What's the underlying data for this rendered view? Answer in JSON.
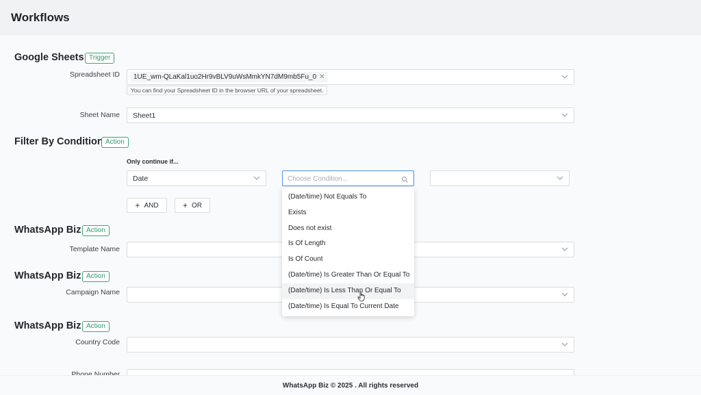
{
  "header": {
    "title": "Workflows"
  },
  "sections": {
    "google_sheets": {
      "title": "Google Sheets",
      "badge": "Trigger"
    },
    "filter": {
      "title": "Filter By Condition",
      "badge": "Action"
    },
    "whatsapp1": {
      "title": "WhatsApp Biz",
      "badge": "Action"
    },
    "whatsapp2": {
      "title": "WhatsApp Biz",
      "badge": "Action"
    },
    "whatsapp3": {
      "title": "WhatsApp Biz",
      "badge": "Action"
    }
  },
  "fields": {
    "spreadsheet_id": {
      "label": "Spreadsheet ID",
      "tag": "1UE_wm-QLaKal1uo2Hr9vBLV9uWsMmkYN7dM9mb5Fu_0",
      "hint": "You can find your Spreadsheet ID in the browser URL of your spreadsheet."
    },
    "sheet_name": {
      "label": "Sheet Name",
      "value": "Sheet1"
    },
    "template_name": {
      "label": "Template Name",
      "value": ""
    },
    "campaign_name": {
      "label": "Campaign Name",
      "value": ""
    },
    "country_code": {
      "label": "Country Code",
      "value": ""
    },
    "phone_number": {
      "label": "Phone Number",
      "value": ""
    }
  },
  "filter": {
    "intro": "Only continue if...",
    "field_value": "Date",
    "condition_placeholder": "Choose Condition...",
    "and_label": "AND",
    "or_label": "OR",
    "options": [
      "(Date/time) Not Equals To",
      "Exists",
      "Does not exist",
      "Is Of Length",
      "Is Of Count",
      "(Date/time) Is Greater Than Or Equal To",
      "(Date/time) Is Less Than Or Equal To",
      "(Date/time) Is Equal To Current Date"
    ],
    "hovered_option": "(Date/time) Is Less Than Or Equal To"
  },
  "footer": {
    "text": "WhatsApp Biz © 2025 . All rights reserved"
  },
  "colors": {
    "badge": "#2f9a6a",
    "focus": "#4a90e2"
  },
  "icons": [
    "chevron-down-icon",
    "search-icon",
    "plus-icon",
    "close-icon",
    "hand-cursor-icon"
  ]
}
